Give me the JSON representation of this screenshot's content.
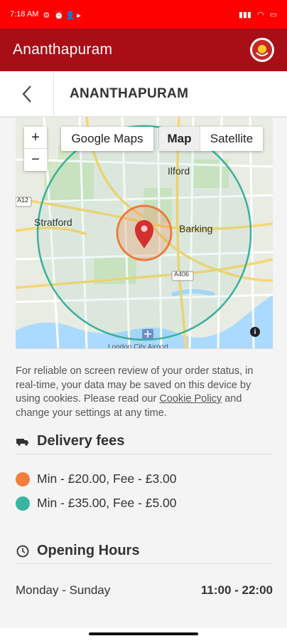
{
  "status_bar": {
    "time": "7:18 AM"
  },
  "app_bar": {
    "title": "Ananthapuram"
  },
  "page": {
    "title": "ANANTHAPURAM"
  },
  "map": {
    "zoom_in": "+",
    "zoom_out": "−",
    "google_maps_btn": "Google Maps",
    "type_map": "Map",
    "type_satellite": "Satellite",
    "labels": {
      "ilford": "Ilford",
      "stratford": "Stratford",
      "barking": "Barking",
      "a12": "A12",
      "a406": "A406"
    },
    "footer": "London City Airport",
    "info": "i",
    "colors": {
      "inner_radius": "#f07a3a",
      "outer_radius": "#3ab09e",
      "pin": "#d32f2f"
    }
  },
  "cookie": {
    "text_before": "For reliable on screen review of your order status, in real-time, your data may be saved on this device by using cookies. Please read our ",
    "link": "Cookie Policy",
    "text_after": " and change your settings at any time."
  },
  "delivery": {
    "title": "Delivery fees",
    "fees": [
      {
        "label": "Min - £20.00, Fee - £3.00",
        "color": "#f37d3b"
      },
      {
        "label": "Min - £35.00, Fee - £5.00",
        "color": "#38b59f"
      }
    ]
  },
  "hours": {
    "title": "Opening Hours",
    "rows": [
      {
        "days": "Monday - Sunday",
        "time": "11:00 - 22:00"
      }
    ]
  }
}
